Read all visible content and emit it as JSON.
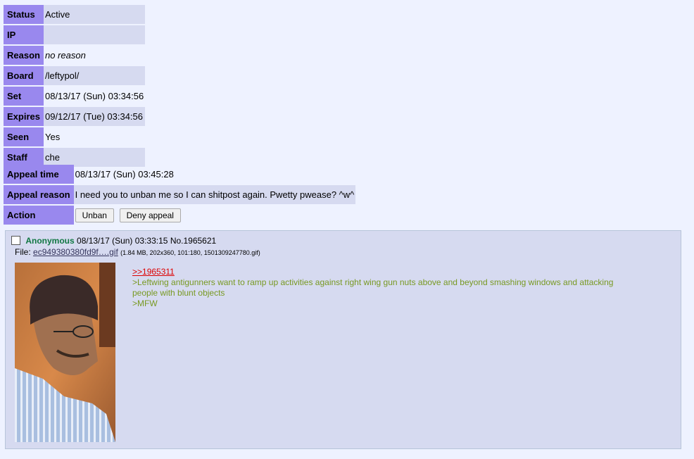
{
  "ban": {
    "rows": [
      {
        "label": "Status",
        "value": "Active"
      },
      {
        "label": "IP",
        "value": ""
      },
      {
        "label": "Reason",
        "value": "no reason"
      },
      {
        "label": "Board",
        "value": "/leftypol/"
      },
      {
        "label": "Set",
        "value": "08/13/17 (Sun) 03:34:56"
      },
      {
        "label": "Expires",
        "value": "09/12/17 (Tue) 03:34:56"
      },
      {
        "label": "Seen",
        "value": "Yes"
      },
      {
        "label": "Staff",
        "value": "che"
      }
    ]
  },
  "appeal": {
    "time_label": "Appeal time",
    "time_value": "08/13/17 (Sun) 03:45:28",
    "reason_label": "Appeal reason",
    "reason_value": "I need you to unban me so I can shitpost again. Pwetty pwease? ^w^",
    "action_label": "Action",
    "unban_label": "Unban",
    "deny_label": "Deny appeal"
  },
  "post": {
    "name": "Anonymous",
    "date": "08/13/17 (Sun) 03:33:15",
    "number": "No.1965621",
    "file_label": "File:",
    "file_name": "ec949380380fd9f….gif",
    "file_meta": "(1.84 MB, 202x360, 101:180, 1501309247780.gif)",
    "reply_link": ">>1965311",
    "quote_line_1": ">Leftwing antigunners want to ramp up activities against right wing gun nuts above and beyond smashing windows and attacking people with blunt objects",
    "quote_line_2": ">MFW"
  },
  "colors": {
    "page_bg": "#eef2ff",
    "header_cell": "#9988ee",
    "value_cell": "#d6daf0",
    "name": "#117743",
    "greentext": "#789922",
    "reply_link": "#dd0000"
  }
}
